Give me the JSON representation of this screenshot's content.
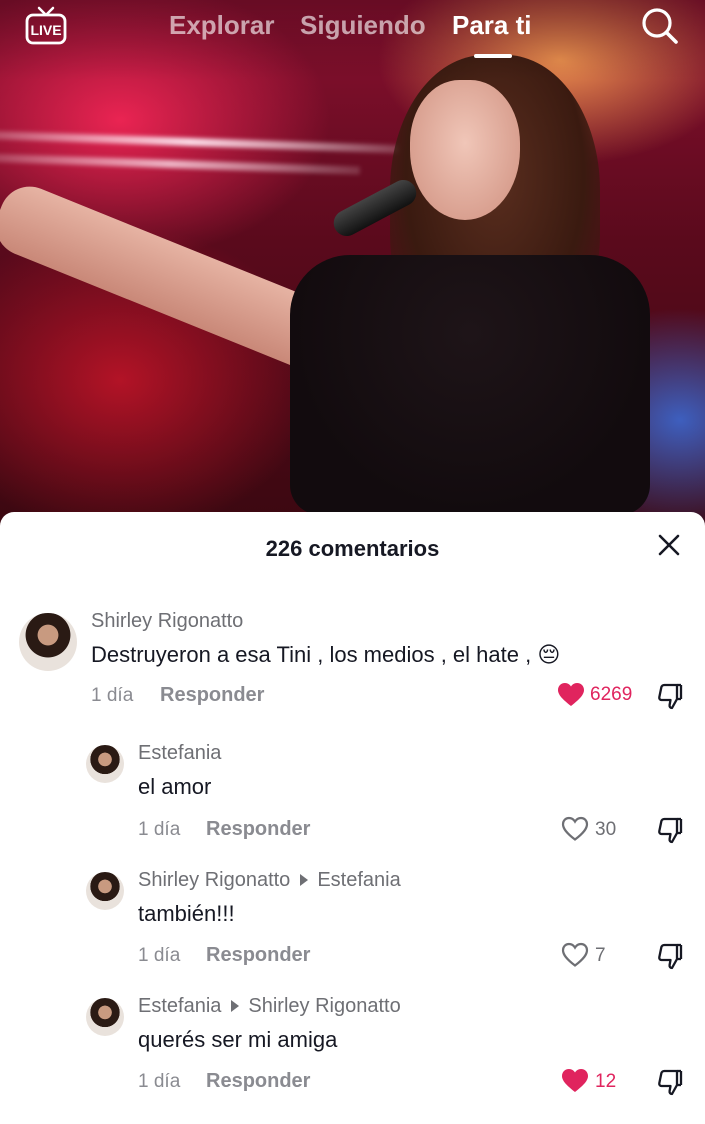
{
  "top_nav": {
    "live_label": "LIVE",
    "tabs": [
      {
        "label": "Explorar"
      },
      {
        "label": "Siguiendo"
      },
      {
        "label": "Para ti"
      }
    ],
    "active_tab": "Para ti"
  },
  "comments_panel": {
    "title": "226 comentarios",
    "comments": [
      {
        "username": "Shirley Rigonatto",
        "reply_to": "",
        "text": "Destruyeron a esa Tini , los medios , el hate , 😔",
        "time": "1 día",
        "reply_label": "Responder",
        "likes": "6269",
        "liked": true
      },
      {
        "username": "Estefania",
        "reply_to": "",
        "text": "el amor",
        "time": "1 día",
        "reply_label": "Responder",
        "likes": "30",
        "liked": false
      },
      {
        "username": "Shirley Rigonatto",
        "reply_to": "Estefania",
        "text": "también!!!",
        "time": "1 día",
        "reply_label": "Responder",
        "likes": "7",
        "liked": false
      },
      {
        "username": "Estefania",
        "reply_to": "Shirley Rigonatto",
        "text": "querés ser mi amiga",
        "time": "1 día",
        "reply_label": "Responder",
        "likes": "12",
        "liked": true
      }
    ]
  },
  "colors": {
    "like_red": "#e0245e",
    "text_dark": "#161823",
    "text_gray": "#8a8b91"
  },
  "icons": [
    "live-tv-icon",
    "search-icon",
    "close-icon",
    "heart-icon",
    "dislike-icon",
    "reply-arrow-icon"
  ]
}
